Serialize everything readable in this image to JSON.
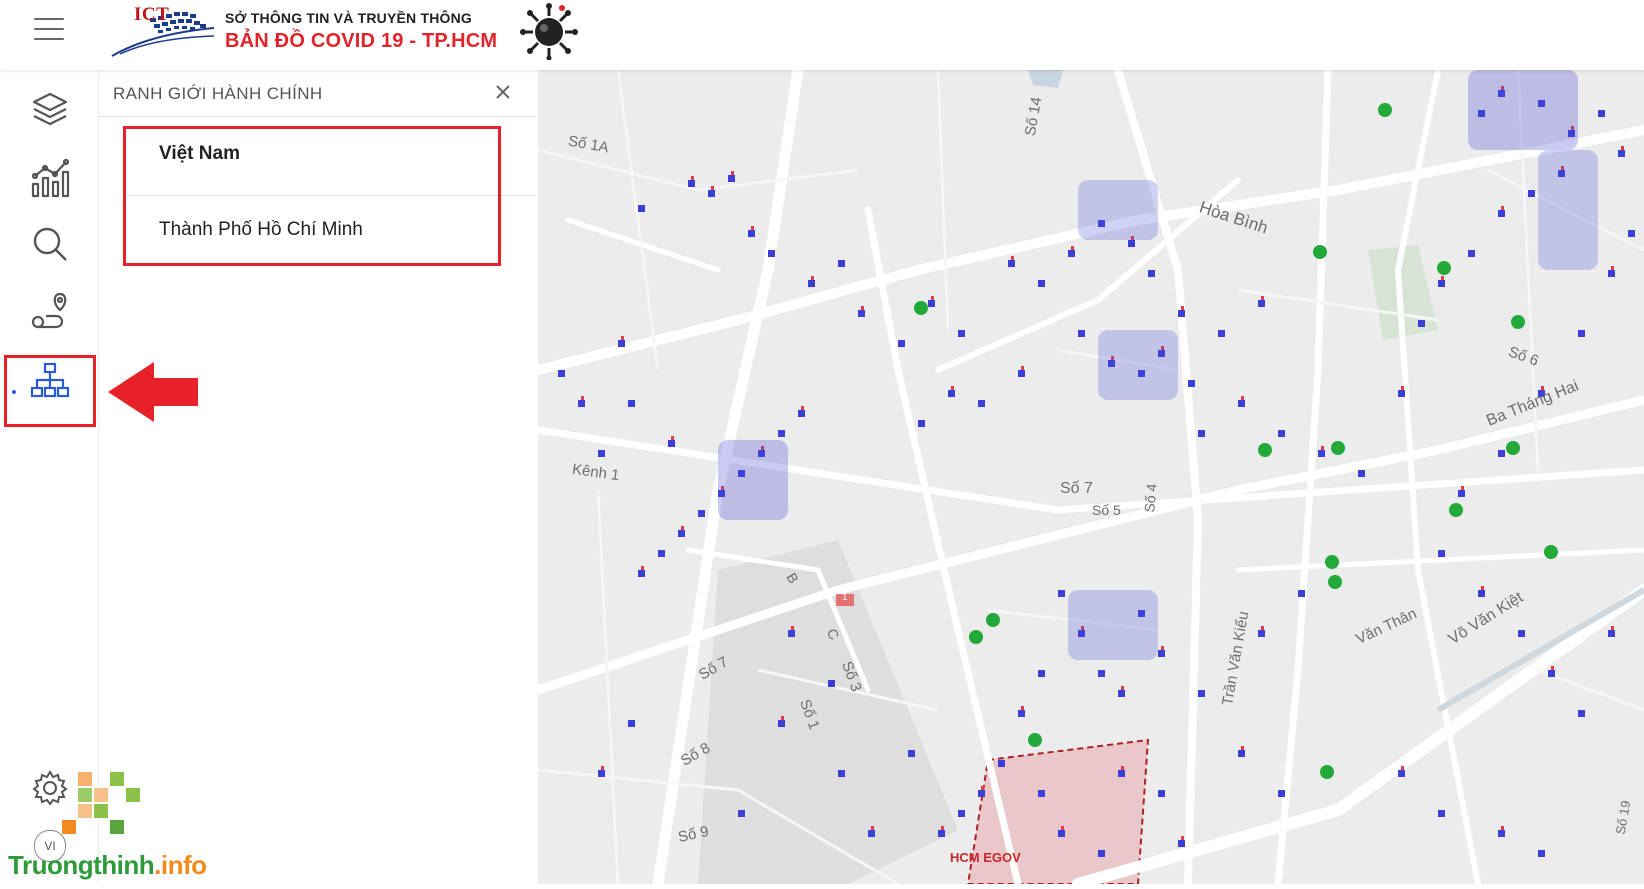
{
  "header": {
    "org_name": "SỞ THÔNG TIN VÀ TRUYỀN THÔNG",
    "app_title": "BẢN ĐỒ  COVID 19 - TP.HCM",
    "logo_text": "ICT"
  },
  "rail": {
    "items": [
      "layers",
      "statistics",
      "search",
      "route",
      "admin-boundary"
    ],
    "active": "admin-boundary",
    "language": "VI"
  },
  "panel": {
    "title": "RANH GIỚI HÀNH CHÍNH",
    "items": [
      {
        "label": "Việt Nam",
        "bold": true
      },
      {
        "label": "Thành Phố Hồ Chí Minh",
        "bold": false
      }
    ]
  },
  "map": {
    "streets": [
      {
        "label": "Số 1A"
      },
      {
        "label": "Số 14"
      },
      {
        "label": "Hòa Bình"
      },
      {
        "label": "Số 6"
      },
      {
        "label": "Ba Tháng Hai"
      },
      {
        "label": "Kênh 1"
      },
      {
        "label": "Số 7"
      },
      {
        "label": "Số 5"
      },
      {
        "label": "Số 4"
      },
      {
        "label": "B"
      },
      {
        "label": "C"
      },
      {
        "label": "1"
      },
      {
        "label": "Số 7"
      },
      {
        "label": "Số 3"
      },
      {
        "label": "Số 1"
      },
      {
        "label": "Số 8"
      },
      {
        "label": "Trần Văn Kiểu"
      },
      {
        "label": "Văn Thân"
      },
      {
        "label": "Võ Văn Kiệt"
      },
      {
        "label": "Số 9"
      },
      {
        "label": "Số 19"
      }
    ]
  },
  "watermark": {
    "brand_main": "Truongthinh",
    "brand_ext": ".info",
    "egov": "HCM EGOV"
  },
  "colors": {
    "accent_red": "#e8202a",
    "case_marker": "#3b3fd6",
    "case_marker_secondary": "#e23b4a",
    "health_marker": "#22a93a",
    "active_icon": "#2a5bd7"
  }
}
